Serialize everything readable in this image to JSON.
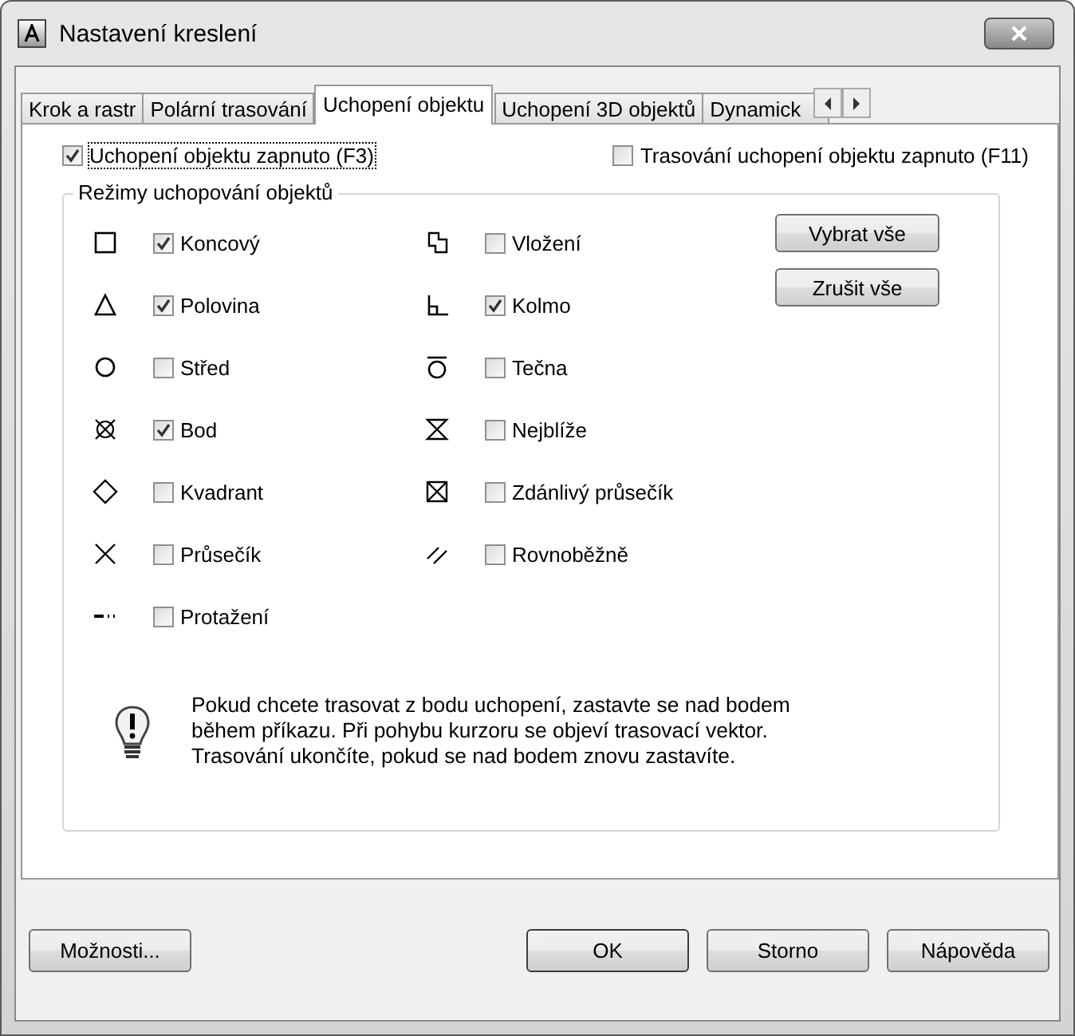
{
  "window": {
    "title": "Nastavení kreslení"
  },
  "tabs": [
    {
      "label": "Krok a rastr",
      "selected": false
    },
    {
      "label": "Polární trasování",
      "selected": false
    },
    {
      "label": "Uchopení objektu",
      "selected": true
    },
    {
      "label": "Uchopení 3D objektů",
      "selected": false
    },
    {
      "label": "Dynamick",
      "selected": false
    }
  ],
  "options": [
    {
      "label": "Uchopení objektu zapnuto (F3)",
      "checked": true,
      "focused": true
    },
    {
      "label": "Trasování uchopení objektu zapnuto (F11)",
      "checked": false,
      "focused": false
    }
  ],
  "snap_modes": {
    "title": "Režimy uchopování objektů",
    "columns": [
      [
        {
          "kind": "endpoint",
          "label": "Koncový",
          "checked": true
        },
        {
          "kind": "midpoint",
          "label": "Polovina",
          "checked": true
        },
        {
          "kind": "center",
          "label": "Střed",
          "checked": false
        },
        {
          "kind": "node",
          "label": "Bod",
          "checked": true
        },
        {
          "kind": "quadrant",
          "label": "Kvadrant",
          "checked": false
        },
        {
          "kind": "intersection",
          "label": "Průsečík",
          "checked": false
        },
        {
          "kind": "extension",
          "label": "Protažení",
          "checked": false
        }
      ],
      [
        {
          "kind": "insertion",
          "label": "Vložení",
          "checked": false
        },
        {
          "kind": "perpendicular",
          "label": "Kolmo",
          "checked": true
        },
        {
          "kind": "tangent",
          "label": "Tečna",
          "checked": false
        },
        {
          "kind": "nearest",
          "label": "Nejblíže",
          "checked": false
        },
        {
          "kind": "apparent",
          "label": "Zdánlivý průsečík",
          "checked": false
        },
        {
          "kind": "parallel",
          "label": "Rovnoběžně",
          "checked": false
        }
      ]
    ],
    "buttons": [
      "Vybrat vše",
      "Zrušit vše"
    ],
    "hint": "Pokud chcete trasovat z bodu uchopení, zastavte se nad bodem během příkazu. Při pohybu kurzoru se objeví trasovací vektor. Trasování ukončíte, pokud se nad bodem znovu zastavíte."
  },
  "footer": {
    "left": "Možnosti...",
    "right": [
      "OK",
      "Storno",
      "Nápověda"
    ]
  }
}
